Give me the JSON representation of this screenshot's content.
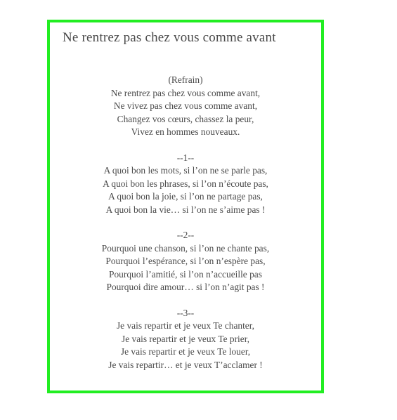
{
  "document": {
    "title": "Ne rentrez pas chez vous comme avant",
    "stanzas": [
      {
        "heading": "(Refrain)",
        "lines": [
          "Ne rentrez pas chez vous comme avant,",
          "Ne vivez pas chez vous comme avant,",
          "Changez vos cœurs, chassez la peur,",
          "Vivez en hommes nouveaux."
        ]
      },
      {
        "heading": "--1--",
        "lines": [
          "A quoi bon les mots, si l’on ne se parle pas,",
          "A quoi bon les phrases, si l’on n’écoute pas,",
          "A quoi bon la joie, si l’on ne partage pas,",
          "A quoi bon la vie… si l’on ne s’aime pas !"
        ]
      },
      {
        "heading": "--2--",
        "lines": [
          "Pourquoi une chanson, si l’on ne chante pas,",
          "Pourquoi l’espérance, si l’on n’espère pas,",
          "Pourquoi l’amitié, si l’on n’accueille pas",
          "Pourquoi dire amour… si l’on n’agit pas !"
        ]
      },
      {
        "heading": "--3--",
        "lines": [
          "Je vais repartir et je veux Te chanter,",
          "Je vais repartir et je veux Te prier,",
          "Je vais repartir et je veux Te louer,",
          "Je vais repartir… et je veux T’acclamer !"
        ]
      }
    ]
  },
  "colors": {
    "frame_border": "#22ee22",
    "text": "#4a4a4a",
    "background": "#ffffff"
  }
}
